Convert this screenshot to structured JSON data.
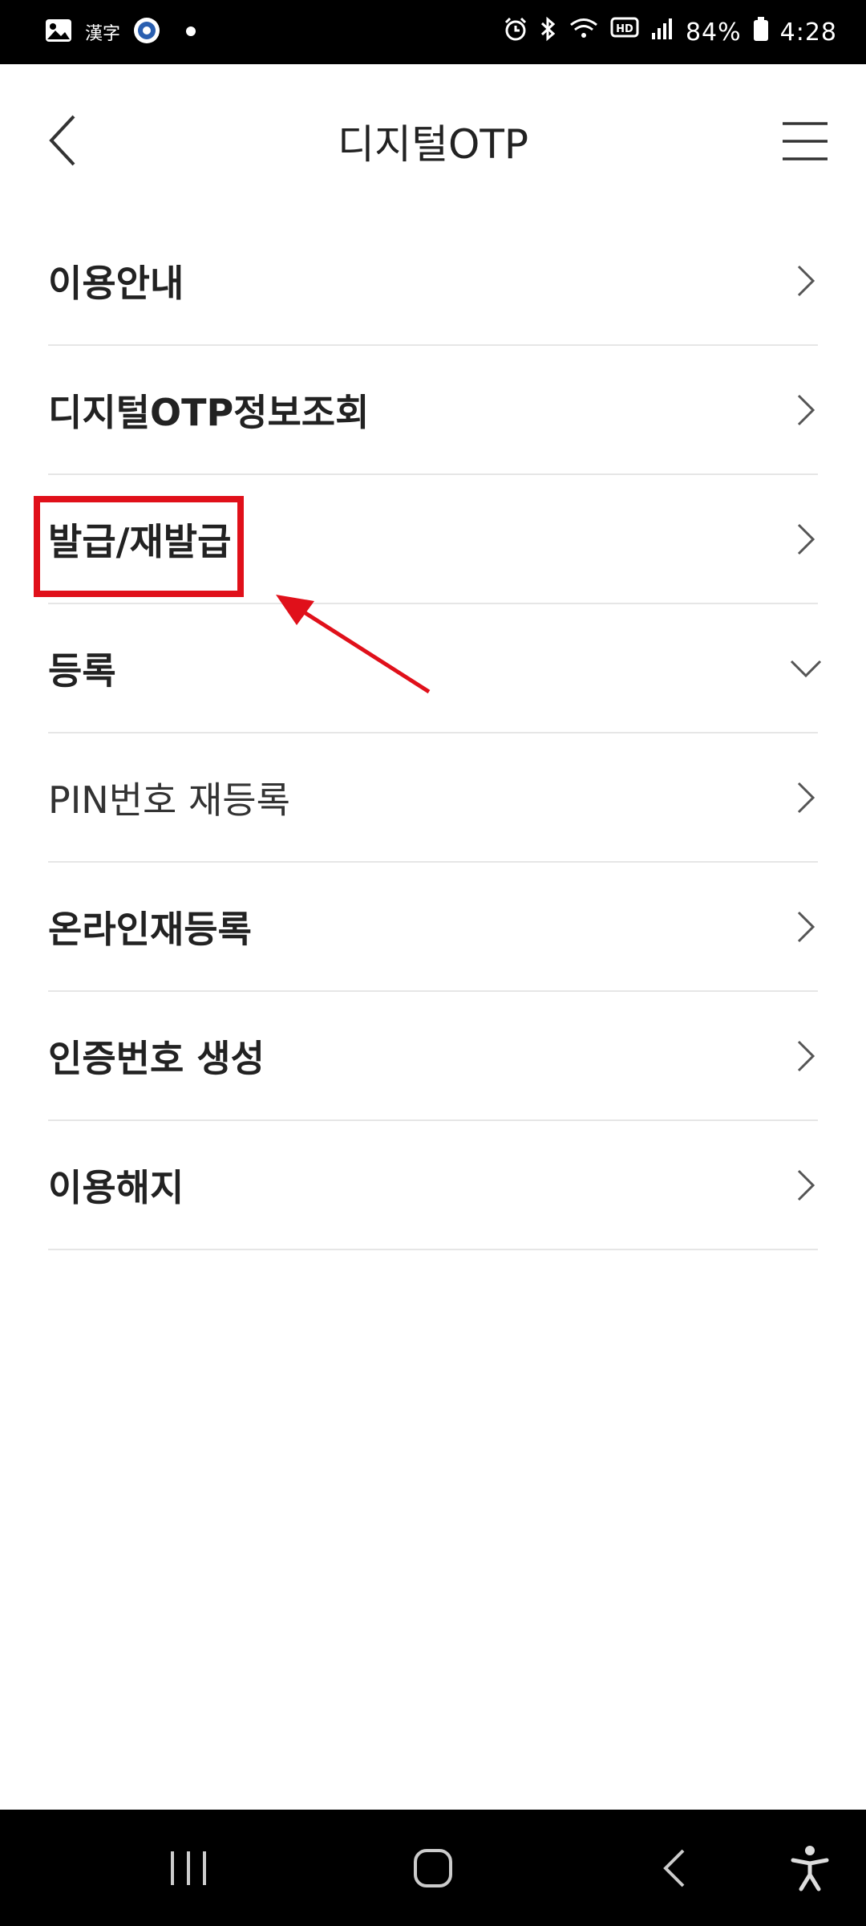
{
  "status_bar": {
    "left_text": "漢字",
    "battery": "84%",
    "time": "4:28"
  },
  "header": {
    "title": "디지털OTP"
  },
  "menu": {
    "items": [
      {
        "label": "이용안내",
        "indicator": "chevron-right-icon"
      },
      {
        "label": "디지털OTP정보조회",
        "indicator": "chevron-right-icon"
      },
      {
        "label": "발급/재발급",
        "indicator": "chevron-right-icon"
      },
      {
        "label": "등록",
        "indicator": "chevron-down-icon"
      },
      {
        "label": "PIN번호 재등록",
        "indicator": "chevron-right-icon"
      },
      {
        "label": "온라인재등록",
        "indicator": "chevron-right-icon"
      },
      {
        "label": "인증번호 생성",
        "indicator": "chevron-right-icon"
      },
      {
        "label": "이용해지",
        "indicator": "chevron-right-icon"
      }
    ]
  },
  "annotation": {
    "color": "#e0101a"
  },
  "nav_bar": {
    "items": [
      "recent-apps-icon",
      "home-icon",
      "back-icon",
      "accessibility-icon"
    ]
  }
}
